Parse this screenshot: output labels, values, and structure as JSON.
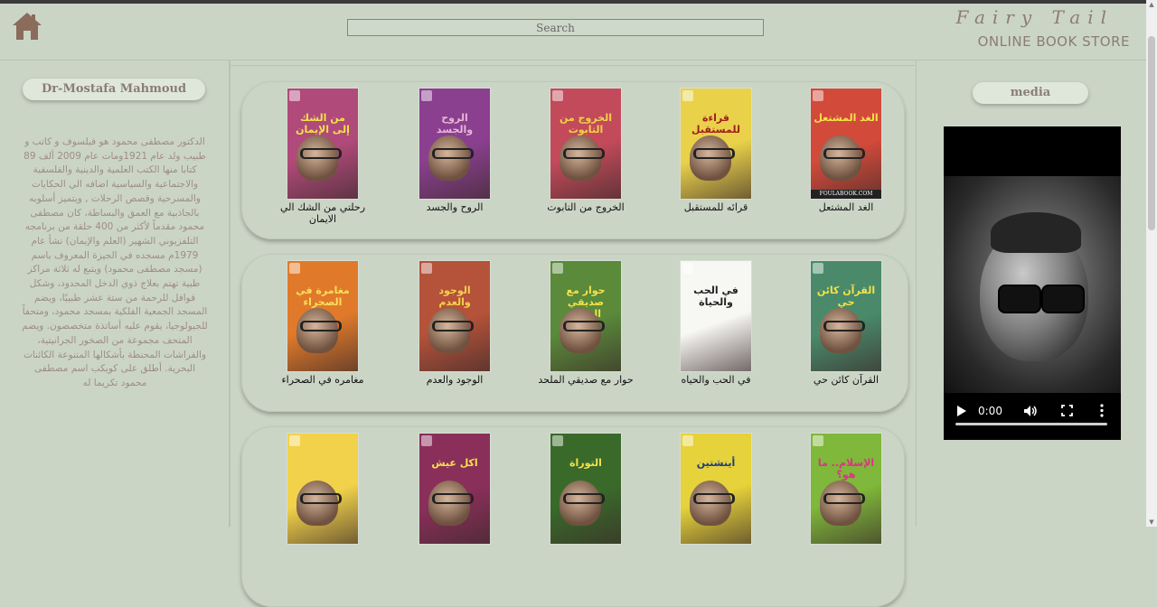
{
  "header": {
    "search_placeholder": "Search",
    "brand_title": "Fairy Tail",
    "brand_subtitle": "ONLINE BOOK STORE",
    "home_icon": "home-icon"
  },
  "sidebar": {
    "author_name": "Dr-Mostafa Mahmoud",
    "bio": "الدكتور مصطفى محمود هو فيلسوف و كاتب و طبيب ولد عام 1921ومات عام 2009 ألف 89 كتابا منها الكتب العلمية والدينية والفلسفية والاجتماعية والسياسية اضافه الي الحكايات والمسرحية وقصص الرحلات , ويتميز أسلوبه بالجاذبية مع العمق والبساطة، كان مصطفى محمود مقدماً لأكثر من 400 حلقة من برنامجه التلفزيوني الشهير (العلم والإيمان) نشأ عام 1979م مسجده في الجيزة المعروف باسم (مسجد مصطفى محمود) ويتبع له ثلاثة مراكز طبية تهتم بعلاج ذوي الدخل المحدود، وشكل قوافل للرحمة من ستة عشر طبيبًا، ويضم المسجد الجمعية الفلكية بمسجد محمود، ومتحفاً للجيولوجيا، يقوم عليه أساتذة متخصصون. ويضم المتحف مجموعة من الصخور الجرانيتية، والفراشات المحنطة بأشكالها المتنوعة الكائنات البحرية. أطلق على كويكب اسم مصطفى محمود تكريما له"
  },
  "books": {
    "row1": [
      {
        "label": "رحلتي من الشك الي الايمان",
        "cover_text": "من الشك إلى الإيمان",
        "bg": "#b04a7a",
        "text": "#f2e24a"
      },
      {
        "label": "الروح والجسد",
        "cover_text": "الروح والجسد",
        "bg": "#8a3f8f",
        "text": "#e8b7d8"
      },
      {
        "label": "الخروج من التابوت",
        "cover_text": "الخروج من التابوت",
        "bg": "#c24a5a",
        "text": "#f1d24a"
      },
      {
        "label": "قرائه للمستقبل",
        "cover_text": "قراءة للمستقبل",
        "bg": "#e9d24a",
        "text": "#a01d1d"
      },
      {
        "label": "الغد المشتعل",
        "cover_text": "الغد المشتعل",
        "bg": "#d24a3a",
        "text": "#f7e24a",
        "strip": "FOULABOOK.COM"
      }
    ],
    "row2": [
      {
        "label": "مغامره في الصحراء",
        "cover_text": "مغامرة في الصحراء",
        "bg": "#e07a2a",
        "text": "#f8e05a"
      },
      {
        "label": "الوجود والعدم",
        "cover_text": "الوجود والعدم",
        "bg": "#b5523a",
        "text": "#f4d24a"
      },
      {
        "label": "حوار مع صديقي الملحد",
        "cover_text": "حوار مع صديقي الملحد",
        "bg": "#5a8a3a",
        "text": "#f4e24a"
      },
      {
        "label": "في الحب والحياه",
        "cover_text": "في الحب والحياة",
        "bg": "#f7f7f4",
        "text": "#222"
      },
      {
        "label": "القرآن كائن حي",
        "cover_text": "القرآن كائن حي",
        "bg": "#4a8a6a",
        "text": "#f4e24a"
      }
    ],
    "row3": [
      {
        "label": "",
        "cover_text": "",
        "bg": "#f2d24a",
        "text": "#222"
      },
      {
        "label": "",
        "cover_text": "اكل عيش",
        "bg": "#8a2f5a",
        "text": "#f4e24a"
      },
      {
        "label": "",
        "cover_text": "التوراة",
        "bg": "#3a6a2a",
        "text": "#f4e24a"
      },
      {
        "label": "",
        "cover_text": "أينشتين",
        "bg": "#e6d23a",
        "text": "#1a3a8a"
      },
      {
        "label": "",
        "cover_text": "الإسلام.. ما هو؟",
        "bg": "#7fb83a",
        "text": "#e0308a"
      }
    ]
  },
  "media": {
    "title": "media",
    "time": "0:00",
    "progress": 0
  }
}
